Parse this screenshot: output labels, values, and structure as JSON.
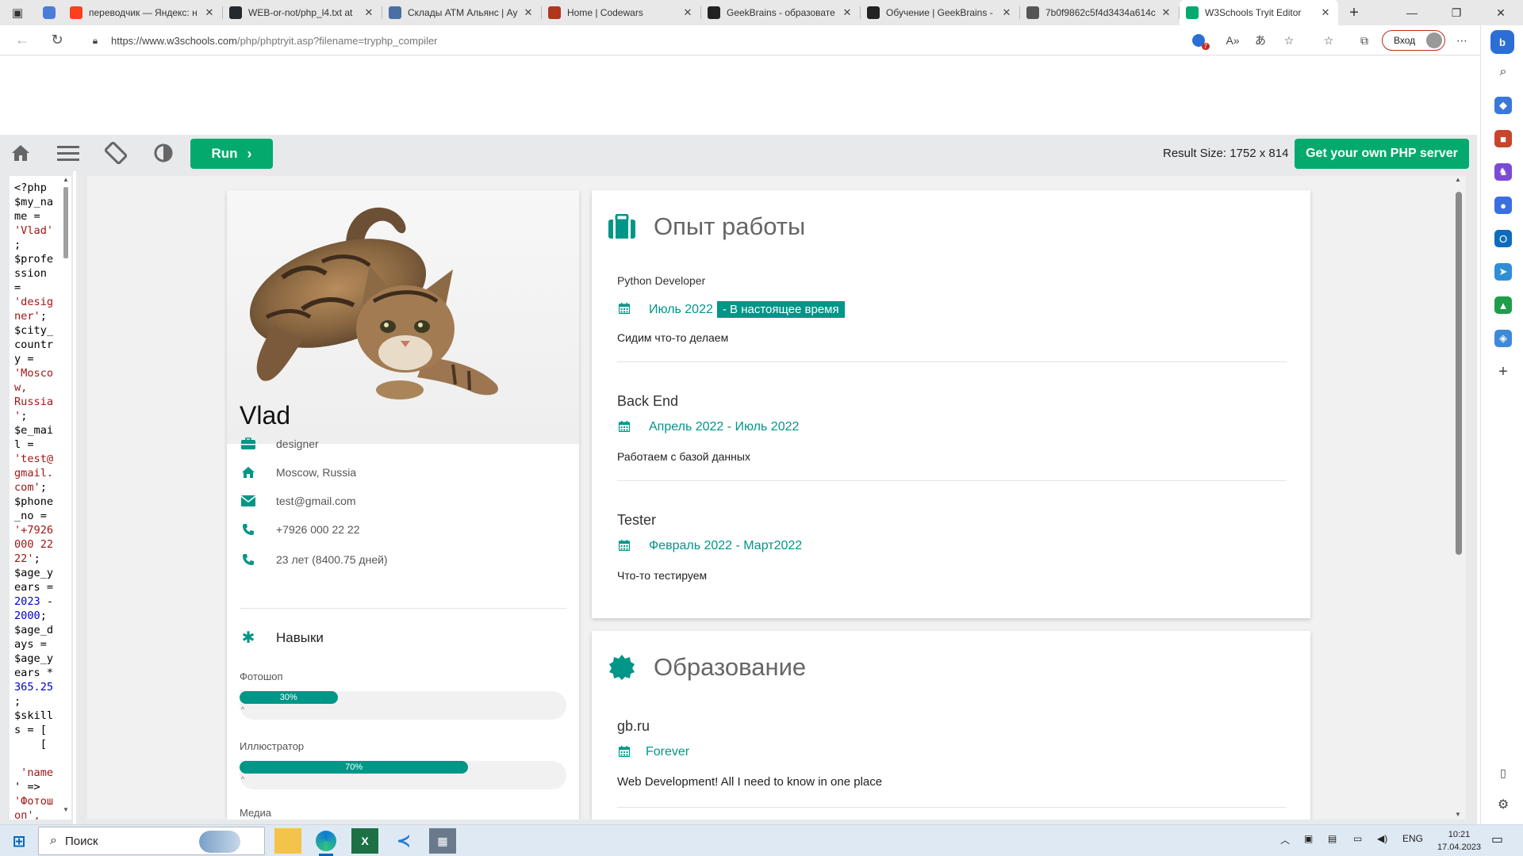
{
  "browser": {
    "tabs": [
      {
        "title": "переводчик — Яндекс: н",
        "favicon_color": "#fc3f1d"
      },
      {
        "title": "WEB-or-not/php_l4.txt at",
        "favicon_color": "#24292f"
      },
      {
        "title": "Склады АТМ Альянс | Ау",
        "favicon_color": "#4a6fa5"
      },
      {
        "title": "Home | Codewars",
        "favicon_color": "#b1361e"
      },
      {
        "title": "GeekBrains - образовате",
        "favicon_color": "#222222"
      },
      {
        "title": "Обучение | GeekBrains -",
        "favicon_color": "#222222"
      },
      {
        "title": "7b0f9862c5f4d3434a614c",
        "favicon_color": "#555555"
      },
      {
        "title": "W3Schools Tryit Editor",
        "favicon_color": "#04aa6d"
      }
    ],
    "url_host": "https://www.w3schools.com",
    "url_path": "/php/phptryit.asp?filename=tryphp_compiler",
    "signin_label": "Вход",
    "notification_count": "7"
  },
  "toolbar": {
    "run_label": "Run",
    "result_size": "Result Size: 1752 x 814",
    "get_server_label": "Get your own PHP server"
  },
  "code_lines": [
    [
      {
        "t": "<?php",
        "c": "k"
      }
    ],
    [
      {
        "t": "$my_na",
        "c": "k"
      }
    ],
    [
      {
        "t": "me =",
        "c": "k"
      }
    ],
    [
      {
        "t": "'Vlad'",
        "c": "s"
      }
    ],
    [
      {
        "t": ";",
        "c": "k"
      }
    ],
    [
      {
        "t": "$profe",
        "c": "k"
      }
    ],
    [
      {
        "t": "ssion",
        "c": "k"
      }
    ],
    [
      {
        "t": "=",
        "c": "k"
      }
    ],
    [
      {
        "t": "'desig",
        "c": "s"
      }
    ],
    [
      {
        "t": "ner'",
        "c": "s"
      },
      {
        "t": ";",
        "c": "k"
      }
    ],
    [
      {
        "t": "$city_",
        "c": "k"
      }
    ],
    [
      {
        "t": "countr",
        "c": "k"
      }
    ],
    [
      {
        "t": "y =",
        "c": "k"
      }
    ],
    [
      {
        "t": "'Mosco",
        "c": "s"
      }
    ],
    [
      {
        "t": "w,",
        "c": "s"
      }
    ],
    [
      {
        "t": "Russia",
        "c": "s"
      }
    ],
    [
      {
        "t": "'",
        "c": "s"
      },
      {
        "t": ";",
        "c": "k"
      }
    ],
    [
      {
        "t": "$e_mai",
        "c": "k"
      }
    ],
    [
      {
        "t": "l =",
        "c": "k"
      }
    ],
    [
      {
        "t": "'test@",
        "c": "s"
      }
    ],
    [
      {
        "t": "gmail.",
        "c": "s"
      }
    ],
    [
      {
        "t": "com'",
        "c": "s"
      },
      {
        "t": ";",
        "c": "k"
      }
    ],
    [
      {
        "t": "$phone",
        "c": "k"
      }
    ],
    [
      {
        "t": "_no =",
        "c": "k"
      }
    ],
    [
      {
        "t": "'+7926",
        "c": "s"
      }
    ],
    [
      {
        "t": "000 22",
        "c": "s"
      }
    ],
    [
      {
        "t": "22'",
        "c": "s"
      },
      {
        "t": ";",
        "c": "k"
      }
    ],
    [
      {
        "t": "$age_y",
        "c": "k"
      }
    ],
    [
      {
        "t": "ears =",
        "c": "k"
      }
    ],
    [
      {
        "t": "2023",
        "c": "n"
      },
      {
        "t": " -",
        "c": "k"
      }
    ],
    [
      {
        "t": "2000",
        "c": "n"
      },
      {
        "t": ";",
        "c": "k"
      }
    ],
    [
      {
        "t": "$age_d",
        "c": "k"
      }
    ],
    [
      {
        "t": "ays =",
        "c": "k"
      }
    ],
    [
      {
        "t": "$age_y",
        "c": "k"
      }
    ],
    [
      {
        "t": "ears *",
        "c": "k"
      }
    ],
    [
      {
        "t": "365.25",
        "c": "n"
      }
    ],
    [
      {
        "t": ";",
        "c": "k"
      }
    ],
    [
      {
        "t": "$skill",
        "c": "k"
      }
    ],
    [
      {
        "t": "s = [",
        "c": "k"
      }
    ],
    [
      {
        "t": "    [",
        "c": "k"
      }
    ],
    [
      {
        "t": "",
        "c": "k"
      }
    ],
    [
      {
        "t": " 'name",
        "c": "s"
      }
    ],
    [
      {
        "t": "' =>",
        "c": "k"
      }
    ],
    [
      {
        "t": "'Фотош",
        "c": "s"
      }
    ],
    [
      {
        "t": "оп',",
        "c": "s"
      }
    ]
  ],
  "profile": {
    "name": "Vlad",
    "info": [
      {
        "icon": "briefcase-icon",
        "text": "designer"
      },
      {
        "icon": "home-icon",
        "text": "Moscow, Russia"
      },
      {
        "icon": "envelope-icon",
        "text": "test@gmail.com"
      },
      {
        "icon": "phone-icon",
        "text": "+7926 000 22 22"
      },
      {
        "icon": "phone-icon",
        "text": "23 лет (8400.75 дней)"
      }
    ],
    "skills_heading": "Навыки",
    "skills": [
      {
        "name": "Фотошоп",
        "percent": 30,
        "label": "30%"
      },
      {
        "name": "Иллюстратор",
        "percent": 70,
        "label": "70%"
      }
    ],
    "skill_next_partial": "Медиа"
  },
  "experience": {
    "heading": "Опыт работы",
    "jobs": [
      {
        "title": "Python Developer",
        "date": "Июль 2022",
        "tag": "- В настоящее время",
        "desc": "Сидим что-то делаем"
      },
      {
        "title": "Back End",
        "date": "Апрель 2022 - Июль 2022",
        "tag": "",
        "desc": "Работаем с базой данных"
      },
      {
        "title": "Tester",
        "date": "Февраль 2022 - Март2022",
        "tag": "",
        "desc": "Что-то тестируем"
      }
    ]
  },
  "education": {
    "heading": "Образование",
    "items": [
      {
        "title": "gb.ru",
        "date": "Forever",
        "desc": "Web Development! All I need to know in one place"
      }
    ]
  },
  "taskbar": {
    "search_placeholder": "Поиск",
    "lang": "ENG",
    "time": "10:21",
    "date": "17.04.2023"
  },
  "colors": {
    "accent": "#009688",
    "w3green": "#04aa6d"
  }
}
